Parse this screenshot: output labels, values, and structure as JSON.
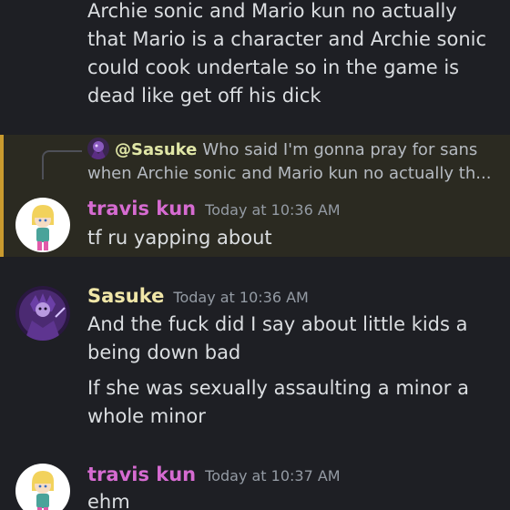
{
  "messages": {
    "top_continuation": {
      "text": "Archie sonic and Mario kun no actually that Mario is a character and Archie sonic could cook undertale so in the game is dead like get off his dick"
    },
    "reply_message": {
      "reply_to": {
        "author": "@Sasuke",
        "preview": "Who said I'm gonna pray for sans when Archie sonic and Mario kun no actually th..."
      },
      "author": "travis kun",
      "timestamp": "Today at 10:36 AM",
      "text": "tf ru yapping about"
    },
    "sasuke_message": {
      "author": "Sasuke",
      "timestamp": "Today at 10:36 AM",
      "lines": [
        "And the fuck did I say about little kids a being down bad",
        "If she was sexually assaulting a minor a whole minor"
      ]
    },
    "travis_last": {
      "author": "travis kun",
      "timestamp": "Today at 10:37 AM",
      "text": "ehm"
    }
  },
  "colors": {
    "background": "#1e1f24",
    "mention_highlight": "#2b2a21",
    "mention_bar": "#c99a2e",
    "travis_name": "#d66bd1",
    "sasuke_name": "#f0e6a8",
    "timestamp": "#949ba4"
  }
}
